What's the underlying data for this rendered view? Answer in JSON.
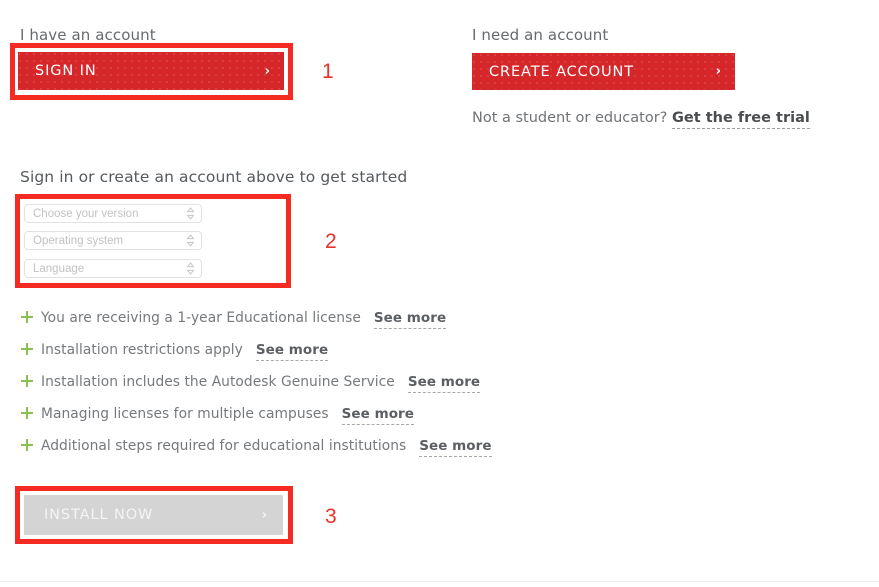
{
  "accounts": {
    "have_account_label": "I have an account",
    "need_account_label": "I need an account",
    "signin_button": "SIGN IN",
    "create_account_button": "CREATE ACCOUNT",
    "chevron": "›",
    "trial_prefix": "Not a student or educator?",
    "trial_link": "Get the free trial"
  },
  "config": {
    "headline": "Sign in or create an account above to get started",
    "selects": [
      {
        "name": "version",
        "value": "Choose your version"
      },
      {
        "name": "os",
        "value": "Operating system"
      },
      {
        "name": "language",
        "value": "Language"
      }
    ]
  },
  "features": [
    {
      "text": "You are receiving a 1-year Educational license",
      "link": "See more"
    },
    {
      "text": "Installation restrictions apply",
      "link": "See more"
    },
    {
      "text": "Installation includes the Autodesk Genuine Service",
      "link": "See more"
    },
    {
      "text": "Managing licenses for multiple campuses",
      "link": "See more"
    },
    {
      "text": "Additional steps required for educational institutions",
      "link": "See more"
    }
  ],
  "install": {
    "button_label": "INSTALL NOW",
    "chevron": "›"
  },
  "annotations": {
    "numbers": [
      "1",
      "2",
      "3"
    ]
  },
  "colors": {
    "brand_red": "#d5262a",
    "annotation_red": "#f52a20",
    "annotation_number_red": "#e8322a",
    "plus_green": "#8cc152",
    "text_gray": "#75797d",
    "disabled_gray": "#d4d4d4"
  }
}
